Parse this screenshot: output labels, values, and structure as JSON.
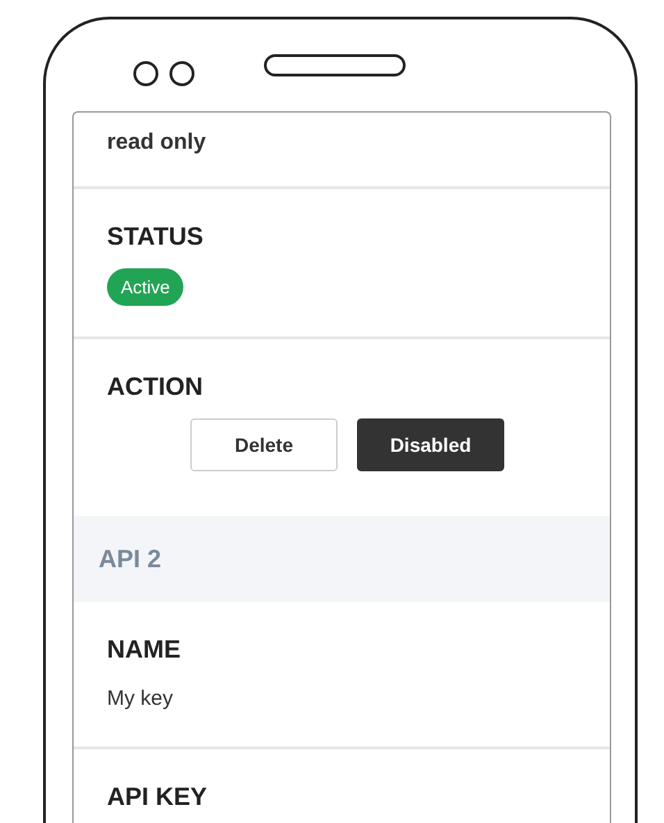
{
  "rows": [
    {
      "kind": "text",
      "value": "read only"
    },
    {
      "kind": "badge",
      "label": "STATUS",
      "value": "Active"
    },
    {
      "kind": "actions",
      "label": "ACTION",
      "buttons": [
        {
          "label": "Delete",
          "kind": "outline"
        },
        {
          "label": "Disabled",
          "kind": "filled"
        }
      ]
    },
    {
      "kind": "header",
      "value": "API 2"
    },
    {
      "kind": "field",
      "label": "NAME",
      "value": "My key"
    },
    {
      "kind": "field",
      "label": "API KEY"
    }
  ]
}
